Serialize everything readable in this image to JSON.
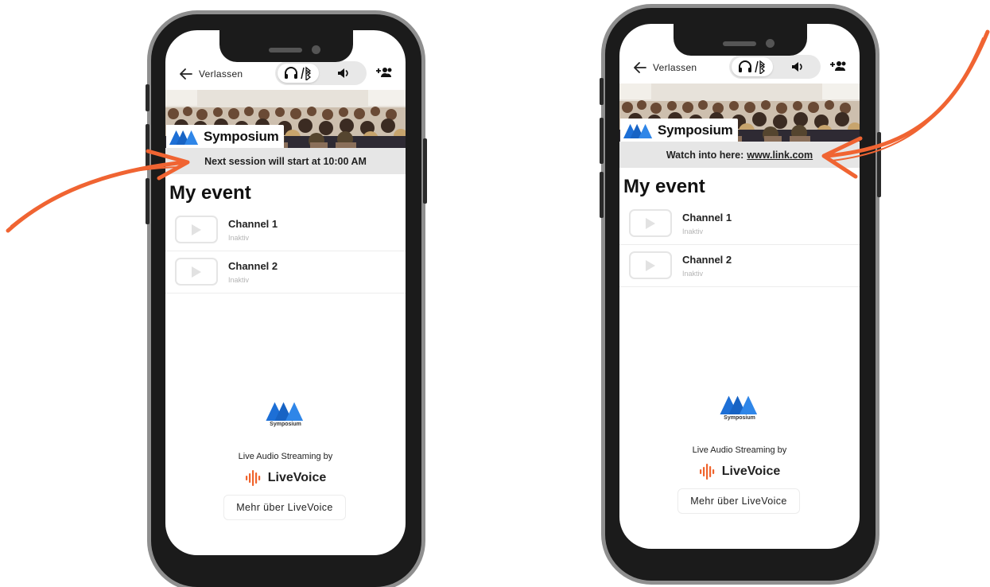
{
  "colors": {
    "accent_arrow": "#f06432",
    "brand_blue": "#1d6fd6",
    "livevoice_orange": "#f0642d",
    "phone_frame": "#1b1b1b",
    "info_strip_bg": "#e6e6e6"
  },
  "phones": [
    {
      "topbar": {
        "back_label": "Verlassen",
        "back_icon": "arrow-left-icon",
        "headphones_icon": "headphones-bluetooth-icon",
        "speaker_icon": "speaker-icon",
        "add_user_icon": "add-user-icon"
      },
      "banner": {
        "brand": "Symposium"
      },
      "info": {
        "text": "Next session will start at 10:00 AM",
        "link": ""
      },
      "event_title": "My event",
      "channels": [
        {
          "name": "Channel 1",
          "status": "Inaktiv"
        },
        {
          "name": "Channel 2",
          "status": "Inaktiv"
        }
      ],
      "footer": {
        "logo_text": "Symposium",
        "streaming_label": "Live Audio Streaming by",
        "livevoice": "LiveVoice",
        "more_button": "Mehr über LiveVoice"
      }
    },
    {
      "topbar": {
        "back_label": "Verlassen",
        "back_icon": "arrow-left-icon",
        "headphones_icon": "headphones-bluetooth-icon",
        "speaker_icon": "speaker-icon",
        "add_user_icon": "add-user-icon"
      },
      "banner": {
        "brand": "Symposium"
      },
      "info": {
        "text": "Watch into here:",
        "link": "www.link.com"
      },
      "event_title": "My event",
      "channels": [
        {
          "name": "Channel 1",
          "status": "Inaktiv"
        },
        {
          "name": "Channel 2",
          "status": "Inaktiv"
        }
      ],
      "footer": {
        "logo_text": "Symposium",
        "streaming_label": "Live Audio Streaming by",
        "livevoice": "LiveVoice",
        "more_button": "Mehr über LiveVoice"
      }
    }
  ]
}
